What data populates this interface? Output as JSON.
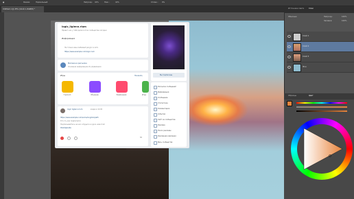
{
  "options_bar": {
    "mode_label": "Режим:",
    "mode_value": "Нормальный",
    "opacity_label": "Непрозр.:",
    "opacity_value": "41%",
    "flow_label": "Наж.:",
    "flow_value": "41%",
    "smooth_label": "Сглаж.:",
    "smooth_value": "0%"
  },
  "document": {
    "tab_title": "Untitled-1 @ 25% (Слой 1, RGB/8) *"
  },
  "vk": {
    "group_name": "logic_liglenn.rium",
    "group_status": "Привет как у тебя дела в этом сообществе сегодня",
    "info_title": "Информация",
    "info_line1": "Не только ваш любимый ресурс в сети",
    "info_line2": "https://www.example.com/logic.rium",
    "manage_title": "Магазин в рассылке",
    "manage_sub": "Основная информация об управлении",
    "apps_title": "Игры",
    "apps_more": "Показать",
    "apps": [
      {
        "label": "Гороскоп",
        "color": "#f5b800"
      },
      {
        "label": "Обучение",
        "color": "#8b4cff"
      },
      {
        "label": "Развлечения",
        "color": "#ff4b6e"
      },
      {
        "label": "Игры",
        "color": "#4bb34b"
      }
    ],
    "post_author": "logic liglenn.rium",
    "post_meta": "вчера в 12:00",
    "post_line1": "https://www.example.com/some/long/link/path",
    "post_line2": "Кто-то уже подписался",
    "post_line3": "Подписывайтесь на нас и будьте в курсе новостей",
    "post_tag": "#мойдизайн",
    "post_views": "66",
    "cover_caption": "Вы подписаны",
    "side_menu": [
      "Рассылка сообщений",
      "Информация",
      "Сообщение",
      "Статистика",
      "Комментарии",
      "События",
      "Сайт из сообщества",
      "Реклама",
      "Поиск рекламы",
      "Рекламная кампания",
      "Весь сообщество"
    ]
  },
  "right_panel": {
    "tabs": [
      "Источники света",
      "Слои"
    ],
    "blend_value": "Обычные",
    "opacity_label": "Непрозр.:",
    "opacity_value": "100%",
    "fill_label": "Заливка:",
    "fill_value": "100%",
    "layers": [
      {
        "name": "Слой 1"
      },
      {
        "name": "Слой 2"
      },
      {
        "name": "Слой 3"
      },
      {
        "name": "Фон"
      }
    ],
    "color_tabs": [
      "Образцы",
      "Цвет"
    ],
    "fg_color": "#e8843c"
  }
}
